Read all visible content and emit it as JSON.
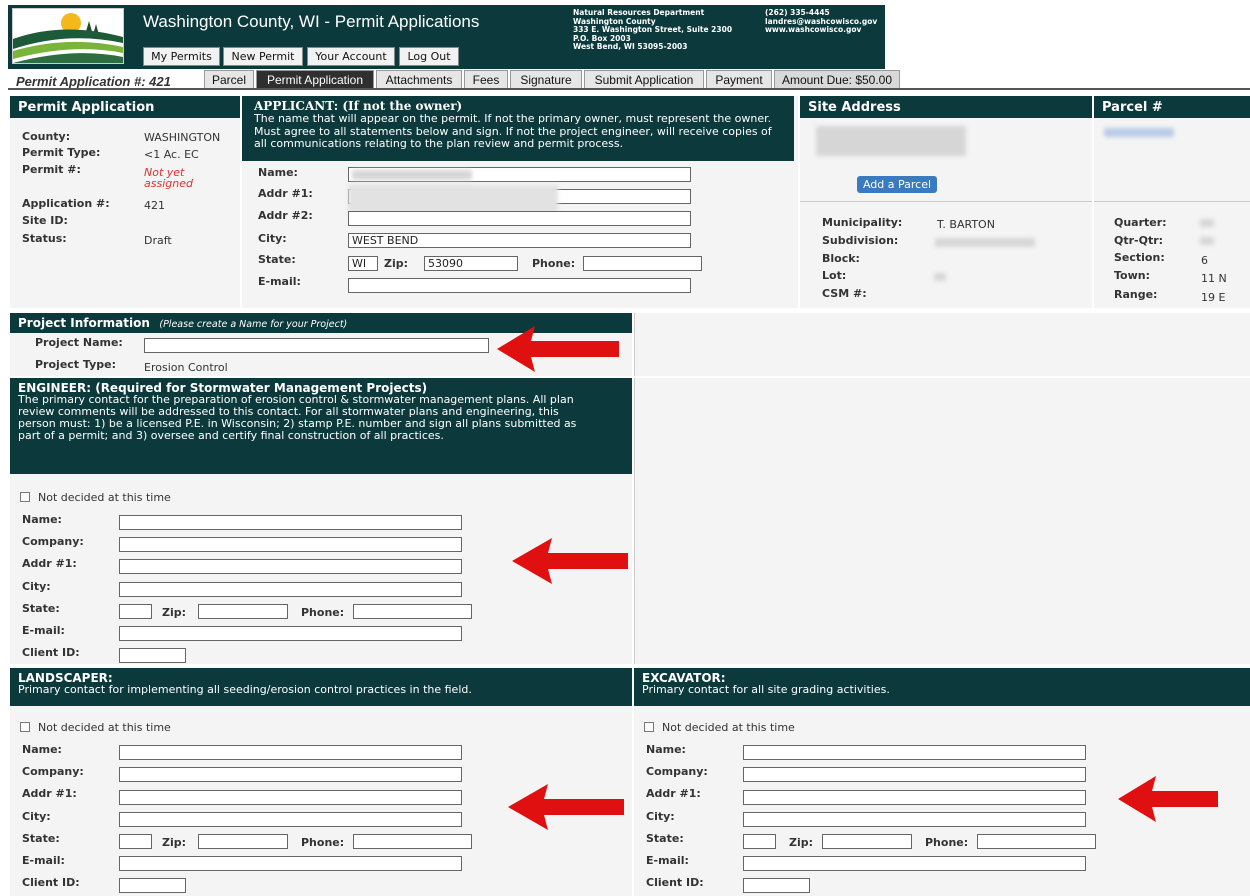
{
  "header": {
    "title": "Washington County, WI - Permit Applications",
    "nav": [
      "My Permits",
      "New Permit",
      "Your Account",
      "Log Out"
    ],
    "dept": {
      "line1": "Natural Resources Department",
      "line2": "Washington County",
      "line3": "333 E. Washington Street, Suite 2300",
      "line4": "P.O. Box 2003",
      "line5": "West Bend, WI 53095-2003"
    },
    "contact": {
      "phone": "(262) 335-4445",
      "email": "landres@washcowisco.gov",
      "web": "www.washcowisco.gov"
    }
  },
  "tabs": {
    "app_no": "Permit Application #: 421",
    "items": [
      "Parcel",
      "Permit Application",
      "Attachments",
      "Fees",
      "Signature",
      "Submit Application",
      "Payment",
      "Amount Due: $50.00"
    ]
  },
  "permit": {
    "heading": "Permit Application",
    "county_label": "County:",
    "county": "WASHINGTON",
    "type_label": "Permit Type:",
    "type": "<1 Ac. EC",
    "permit_no_label": "Permit #:",
    "permit_no": "Not yet assigned",
    "app_no_label": "Application #:",
    "app_no": "421",
    "site_id_label": "Site ID:",
    "status_label": "Status:",
    "status": "Draft"
  },
  "applicant": {
    "heading": "APPLICANT: (If not the owner)",
    "desc": "The name that will appear on the permit. If not the primary owner, must represent the owner. Must agree to all statements below and sign. If not the project engineer, will receive copies of all communications relating to the plan review and permit process.",
    "name_label": "Name:",
    "addr1_label": "Addr #1:",
    "addr2_label": "Addr #2:",
    "city_label": "City:",
    "city": "WEST BEND",
    "state_label": "State:",
    "state": "WI",
    "zip_label": "Zip:",
    "zip": "53090",
    "phone_label": "Phone:",
    "email_label": "E-mail:"
  },
  "site": {
    "heading": "Site Address",
    "add_parcel": "Add a Parcel",
    "muni_label": "Municipality:",
    "muni": "T. BARTON",
    "subdiv_label": "Subdivision:",
    "block_label": "Block:",
    "lot_label": "Lot:",
    "csm_label": "CSM #:"
  },
  "parcel": {
    "heading": "Parcel #",
    "quarter_label": "Quarter:",
    "qtrqtr_label": "Qtr-Qtr:",
    "section_label": "Section:",
    "section": "6",
    "town_label": "Town:",
    "town": "11 N",
    "range_label": "Range:",
    "range": "19 E"
  },
  "project": {
    "heading": "Project Information",
    "hint": "(Please create a Name for your Project)",
    "name_label": "Project Name:",
    "type_label": "Project Type:",
    "type": "Erosion Control"
  },
  "engineer": {
    "heading": "ENGINEER: (Required for Stormwater Management Projects)",
    "desc": "The primary contact for the preparation of erosion control & stormwater management plans. All plan review comments will be addressed to this contact. For all stormwater plans and engineering, this person must: 1) be a licensed P.E. in Wisconsin; 2) stamp P.E. number and sign all plans submitted as part of a permit; and 3) oversee and certify final construction of all practices.",
    "not_decided": "Not decided at this time",
    "labels": {
      "name": "Name:",
      "company": "Company:",
      "addr1": "Addr #1:",
      "city": "City:",
      "state": "State:",
      "zip": "Zip:",
      "phone": "Phone:",
      "email": "E-mail:",
      "client": "Client ID:"
    }
  },
  "landscaper": {
    "heading": "LANDSCAPER:",
    "desc": "Primary contact for implementing all seeding/erosion control practices in the field.",
    "not_decided": "Not decided at this time",
    "labels": {
      "name": "Name:",
      "company": "Company:",
      "addr1": "Addr #1:",
      "city": "City:",
      "state": "State:",
      "zip": "Zip:",
      "phone": "Phone:",
      "email": "E-mail:",
      "client": "Client ID:"
    }
  },
  "excavator": {
    "heading": "EXCAVATOR:",
    "desc": "Primary contact for all site grading activities.",
    "not_decided": "Not decided at this time",
    "labels": {
      "name": "Name:",
      "company": "Company:",
      "addr1": "Addr #1:",
      "city": "City:",
      "state": "State:",
      "zip": "Zip:",
      "phone": "Phone:",
      "email": "E-mail:",
      "client": "Client ID:"
    }
  },
  "colors": {
    "header_bg": "#0c3a3c",
    "arrow": "#e01010",
    "panel_bg": "#f4f4f4",
    "link_blue": "#2f6db5"
  }
}
